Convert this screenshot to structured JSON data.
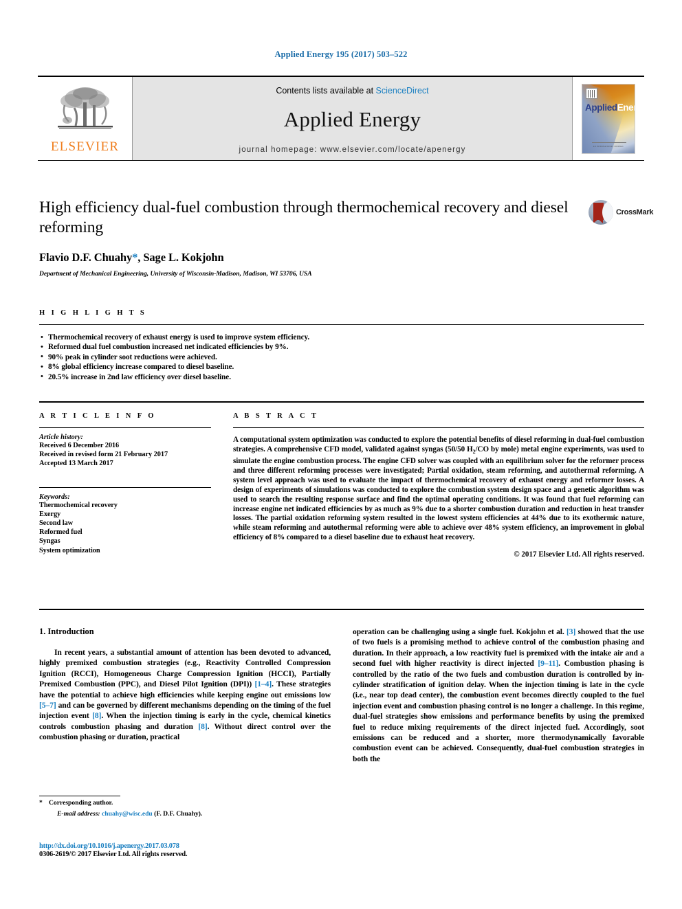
{
  "running_head": "Applied Energy 195 (2017) 503–522",
  "masthead": {
    "contents_prefix": "Contents lists available at",
    "sciencedirect": "ScienceDirect",
    "journal_name": "Applied Energy",
    "homepage": "journal homepage: www.elsevier.com/locate/apenergy",
    "publisher_logo_text": "ELSEVIER",
    "cover": {
      "title_part1": "Applied",
      "title_part2": "Energy",
      "footer_text": "AN INTERNATIONAL JOURNAL"
    },
    "accent_link_color": "#1a7fc1",
    "band_bg_color": "#e4e4e4",
    "elsevier_orange": "#ef7c1a"
  },
  "article": {
    "title": "High efficiency dual-fuel combustion through thermochemical recovery and diesel reforming",
    "authors_pre": "Flavio D.F. Chuahy",
    "authors_star": "*",
    "authors_post": ", Sage L. Kokjohn",
    "affiliation": "Department of Mechanical Engineering, University of Wisconsin-Madison, Madison, WI 53706, USA",
    "crossmark_label": "CrossMark"
  },
  "highlights": {
    "heading": "H I G H L I G H T S",
    "items": [
      "Thermochemical recovery of exhaust energy is used to improve system efficiency.",
      "Reformed dual fuel combustion increased net indicated efficiencies by 9%.",
      "90% peak in cylinder soot reductions were achieved.",
      "8% global efficiency increase compared to diesel baseline.",
      "20.5% increase in 2nd law efficiency over diesel baseline."
    ]
  },
  "article_info": {
    "heading": "A R T I C L E   I N F O",
    "history_label": "Article history:",
    "history": [
      "Received 6 December 2016",
      "Received in revised form 21 February 2017",
      "Accepted 13 March 2017"
    ],
    "keywords_label": "Keywords:",
    "keywords": [
      "Thermochemical recovery",
      "Exergy",
      "Second law",
      "Reformed fuel",
      "Syngas",
      "System optimization"
    ]
  },
  "abstract": {
    "heading": "A B S T R A C T",
    "part1": "A computational system optimization was conducted to explore the potential benefits of diesel reforming in dual-fuel combustion strategies. A comprehensive CFD model, validated against syngas (50/50 H",
    "subscript": "2",
    "part2": "/CO by mole) metal engine experiments, was used to simulate the engine combustion process. The engine CFD solver was coupled with an equilibrium solver for the reformer process and three different reforming processes were investigated; Partial oxidation, steam reforming, and autothermal reforming. A system level approach was used to evaluate the impact of thermochemical recovery of exhaust energy and reformer losses. A design of experiments of simulations was conducted to explore the combustion system design space and a genetic algorithm was used to search the resulting response surface and find the optimal operating conditions. It was found that fuel reforming can increase engine net indicated efficiencies by as much as 9% due to a shorter combustion duration and reduction in heat transfer losses. The partial oxidation reforming system resulted in the lowest system efficiencies at 44% due to its exothermic nature, while steam reforming and autothermal reforming were able to achieve over 48% system efficiency, an improvement in global efficiency of 8% compared to a diesel baseline due to exhaust heat recovery.",
    "copyright": "© 2017 Elsevier Ltd. All rights reserved."
  },
  "introduction": {
    "heading": "1. Introduction",
    "left_p1_a": "In recent years, a substantial amount of attention has been devoted to advanced, highly premixed combustion strategies (e.g., Reactivity Controlled Compression Ignition (RCCI), Homogeneous Charge Compression Ignition (HCCI), Partially Premixed Combustion (PPC), and Diesel Pilot Ignition (DPI)) ",
    "cite_1_4": "[1–4]",
    "left_p1_b": ". These strategies have the potential to achieve high efficiencies while keeping engine out emissions low ",
    "cite_5_7": "[5–7]",
    "left_p1_c": " and can be governed by different mechanisms depending on the timing of the fuel injection event ",
    "cite_8a": "[8]",
    "left_p1_d": ". When the injection timing is early in the cycle, chemical kinetics controls combustion phasing and duration ",
    "cite_8b": "[8]",
    "left_p1_e": ". Without direct control over the combustion phasing or duration, practical",
    "right_p1_a": "operation can be challenging using a single fuel. Kokjohn et al. ",
    "cite_3": "[3]",
    "right_p1_b": " showed that the use of two fuels is a promising method to achieve control of the combustion phasing and duration. In their approach, a low reactivity fuel is premixed with the intake air and a second fuel with higher reactivity is direct injected ",
    "cite_9_11": "[9–11]",
    "right_p1_c": ". Combustion phasing is controlled by the ratio of the two fuels and combustion duration is controlled by in-cylinder stratification of ignition delay. When the injection timing is late in the cycle (i.e., near top dead center), the combustion event becomes directly coupled to the fuel injection event and combustion phasing control is no longer a challenge. In this regime, dual-fuel strategies show emissions and performance benefits by using the premixed fuel to reduce mixing requirements of the direct injected fuel. Accordingly, soot emissions can be reduced and a shorter, more thermodynamically favorable combustion event can be achieved. Consequently, dual-fuel combustion strategies in both the"
  },
  "footer": {
    "corresponding_star": "*",
    "corresponding_label": "Corresponding author.",
    "email_label": "E-mail address:",
    "email": "chuahy@wisc.edu",
    "email_suffix": "(F. D.F. Chuahy).",
    "doi": "http://dx.doi.org/10.1016/j.apenergy.2017.03.078",
    "issn": "0306-2619/© 2017 Elsevier Ltd. All rights reserved."
  }
}
